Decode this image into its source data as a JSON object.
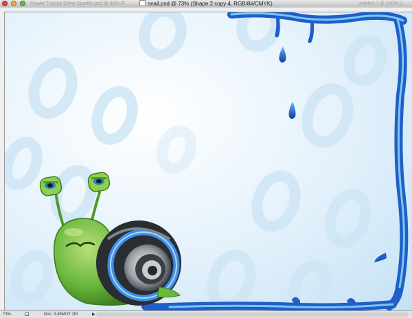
{
  "window": {
    "title": "snail.psd @ 73% (Shape 2 copy 4, RGB/8#/CMYK)",
    "bg_title_left": "Flower Tutorial  Shine  Sparkle.psd @ 66% (F...",
    "bg_title_right": "Untitled-1 @ 100% (L..."
  },
  "status": {
    "zoom": "73%",
    "doc_size": "Doc: 3.49M/37.2M",
    "arrow": "▶"
  },
  "colors": {
    "background_light": "#e3f1fb",
    "pattern": "#c9e3f3",
    "frame_blue": "#1e5fc8",
    "snail_green": "#6ab83c"
  }
}
